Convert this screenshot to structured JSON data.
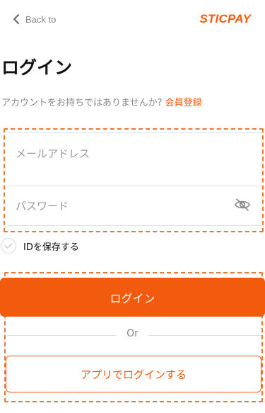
{
  "colors": {
    "accent": "#F25A0E",
    "dashed_outline": "#E67A35",
    "muted_text": "#888888",
    "divider": "#DDDDDD"
  },
  "header": {
    "back_label": "Back to",
    "back_icon": "chevron-left-icon",
    "brand": "STICPAY"
  },
  "page": {
    "title": "ログイン",
    "signup_prompt": "アカウントをお持ちではありませんか?",
    "signup_link": "会員登録"
  },
  "form": {
    "email_placeholder": "メールアドレス",
    "password_placeholder": "パスワード",
    "password_toggle_icon": "eye-slash-icon",
    "remember_label": "IDを保存する",
    "remember_checked": false,
    "login_button": "ログイン",
    "or_text": "Or",
    "app_login_button": "アプリでログインする"
  }
}
